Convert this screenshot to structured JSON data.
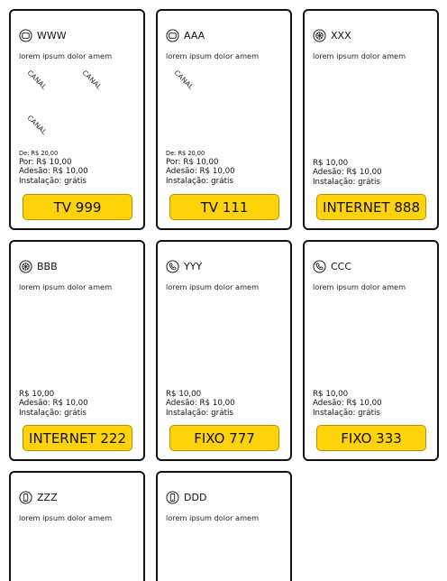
{
  "cards": [
    {
      "name": "WWW",
      "icon": "tv-icon",
      "description": "lorem ipsum dolor amem",
      "channels": [
        "CANAL",
        "CANAL",
        "CANAL"
      ],
      "price_from": "De: R$ 20,00",
      "price": "Por: R$ 10,00",
      "adhesion": "Adesão: R$ 10,00",
      "installation": "Instalação: grátis",
      "cta_label": "TV 999"
    },
    {
      "name": "AAA",
      "icon": "tv-icon",
      "description": "lorem ipsum dolor amem",
      "channels": [
        "CANAL"
      ],
      "price_from": "De: R$ 20,00",
      "price": "Por: R$ 10,00",
      "adhesion": "Adesão: R$ 10,00",
      "installation": "Instalação: grátis",
      "cta_label": "TV 111"
    },
    {
      "name": "XXX",
      "icon": "globe-icon",
      "description": "lorem ipsum dolor amem",
      "price": "R$ 10,00",
      "adhesion": "Adesão: R$ 10,00",
      "installation": "Instalação: grátis",
      "cta_label": "INTERNET 888"
    },
    {
      "name": "BBB",
      "icon": "globe-icon",
      "description": "lorem ipsum dolor amem",
      "price": "R$ 10,00",
      "adhesion": "Adesão: R$ 10,00",
      "installation": "Instalação: grátis",
      "cta_label": "INTERNET 222"
    },
    {
      "name": "YYY",
      "icon": "phone-icon",
      "description": "lorem ipsum dolor amem",
      "price": "R$ 10,00",
      "adhesion": "Adesão: R$ 10,00",
      "installation": "Instalação: grátis",
      "cta_label": "FIXO 777"
    },
    {
      "name": "CCC",
      "icon": "phone-icon",
      "description": "lorem ipsum dolor amem",
      "price": "R$ 10,00",
      "adhesion": "Adesão: R$ 10,00",
      "installation": "Instalação: grátis",
      "cta_label": "FIXO 333"
    },
    {
      "name": "ZZZ",
      "icon": "mobile-icon",
      "description": "lorem ipsum dolor amem"
    },
    {
      "name": "DDD",
      "icon": "mobile-icon",
      "description": "lorem ipsum dolor amem"
    }
  ],
  "colors": {
    "cta_background": "#ffd20a",
    "card_border": "#111111"
  }
}
